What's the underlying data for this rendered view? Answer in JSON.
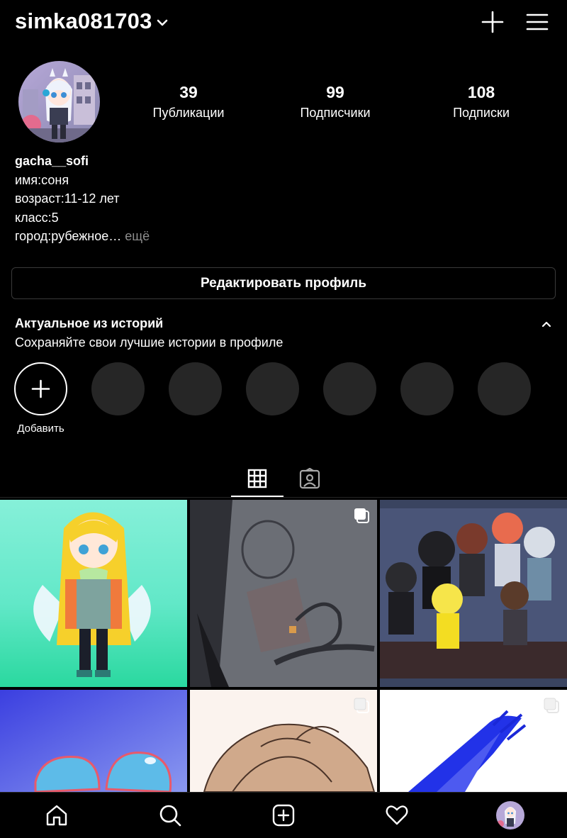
{
  "header": {
    "username": "simka081703"
  },
  "profile": {
    "stats": [
      {
        "value": "39",
        "label": "Публикации"
      },
      {
        "value": "99",
        "label": "Подписчики"
      },
      {
        "value": "108",
        "label": "Подписки"
      }
    ],
    "bio": {
      "name": "gacha__sofi",
      "lines": [
        "имя:соня",
        "возраст:11-12 лет",
        "класс:5"
      ],
      "last_line": "город:рубежное…",
      "more": " ещё"
    },
    "edit_button": "Редактировать профиль"
  },
  "highlights": {
    "title": "Актуальное из историй",
    "subtitle": "Сохраняйте свои лучшие истории в профиле",
    "add_label": "Добавить",
    "placeholder_count": 6
  },
  "tabs": [
    {
      "name": "grid-icon",
      "active": true
    },
    {
      "name": "tagged-icon",
      "active": false
    }
  ],
  "posts": [
    {
      "description": "gacha character blonde with green scarf",
      "multi": false
    },
    {
      "description": "pencil drawing photo",
      "multi": true
    },
    {
      "description": "group of gacha characters",
      "multi": false
    },
    {
      "description": "blue butterfly",
      "multi": false
    },
    {
      "description": "brown hair drawing",
      "multi": true
    },
    {
      "description": "blue brush strokes",
      "multi": true
    }
  ],
  "bottom_nav": [
    {
      "name": "home-icon"
    },
    {
      "name": "search-icon"
    },
    {
      "name": "create-post-icon"
    },
    {
      "name": "activity-heart-icon"
    },
    {
      "name": "profile-avatar"
    }
  ],
  "colors": {
    "background": "#000000",
    "text": "#ffffff",
    "muted": "#8e8e8e",
    "placeholder_circle": "#262626",
    "border": "#3a3a3a"
  }
}
